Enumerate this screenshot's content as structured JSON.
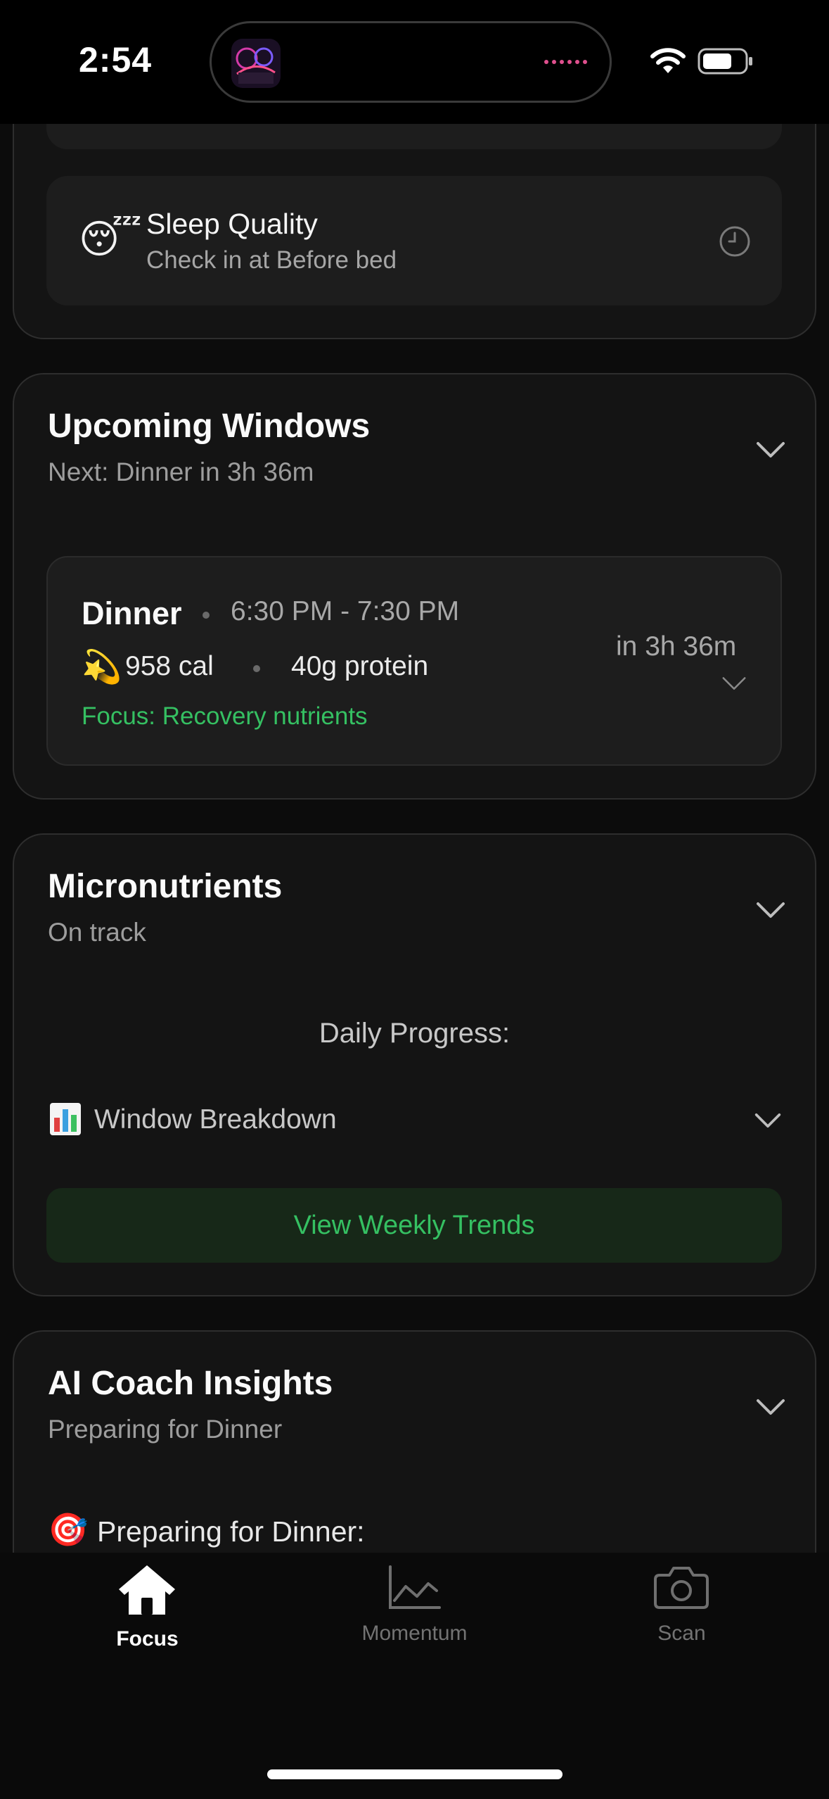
{
  "status_bar": {
    "time": "2:54"
  },
  "sleep_checkin": {
    "icon": "sleeping-face-icon",
    "title": "Sleep Quality",
    "subtitle": "Check in at Before bed"
  },
  "upcoming_windows": {
    "title": "Upcoming Windows",
    "subtitle": "Next: Dinner in 3h 36m",
    "windows": [
      {
        "name": "Dinner",
        "time_range": "6:30 PM - 7:30 PM",
        "calories": "958 cal",
        "protein": "40g protein",
        "focus": "Focus: Recovery nutrients",
        "countdown": "in 3h 36m"
      }
    ]
  },
  "micronutrients": {
    "title": "Micronutrients",
    "subtitle": "On track",
    "daily_progress_label": "Daily Progress:",
    "breakdown_label": "Window Breakdown",
    "trends_button": "View Weekly Trends"
  },
  "ai_coach": {
    "title": "AI Coach Insights",
    "subtitle": "Preparing for Dinner",
    "section_heading": "Preparing for Dinner:"
  },
  "tab_bar": {
    "tabs": [
      {
        "label": "Focus",
        "icon": "home-icon",
        "active": true
      },
      {
        "label": "Momentum",
        "icon": "chart-line-icon",
        "active": false
      },
      {
        "label": "Scan",
        "icon": "camera-icon",
        "active": false
      }
    ]
  },
  "colors": {
    "accent_green": "#35c062",
    "background": "#0c0c0c",
    "card": "#141414"
  }
}
